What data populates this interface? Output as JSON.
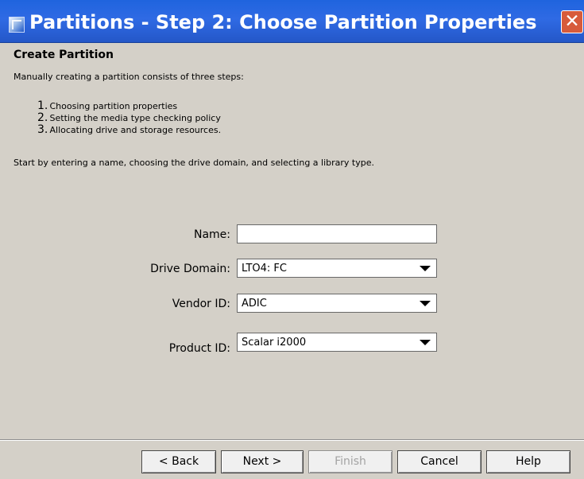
{
  "window": {
    "title": "Partitions - Step 2: Choose Partition Properties",
    "close_glyph": "✕"
  },
  "page": {
    "heading": "Create Partition",
    "intro": "Manually creating a partition consists of three steps:",
    "steps": [
      {
        "number": "1.",
        "text": "Choosing partition properties"
      },
      {
        "number": "2.",
        "text": "Setting the media type checking policy"
      },
      {
        "number": "3.",
        "text": "Allocating drive and storage resources."
      }
    ],
    "instruction": "Start by entering a name, choosing the drive domain, and selecting a library type."
  },
  "form": {
    "name": {
      "label": "Name:",
      "value": ""
    },
    "drive_domain": {
      "label": "Drive Domain:",
      "value": "LTO4: FC"
    },
    "vendor_id": {
      "label": "Vendor ID:",
      "value": "ADIC"
    },
    "product_id": {
      "label": "Product ID:",
      "value": "Scalar i2000"
    }
  },
  "buttons": {
    "back": "< Back",
    "next": "Next >",
    "finish": "Finish",
    "cancel": "Cancel",
    "help": "Help"
  },
  "icons": {
    "app": "partition-window-icon",
    "close": "close-icon",
    "dropdown": "chevron-down-icon"
  },
  "colors": {
    "titlebar": "#2f6ae4",
    "window_background": "#d4d0c8",
    "close_button": "#d75b3b"
  }
}
